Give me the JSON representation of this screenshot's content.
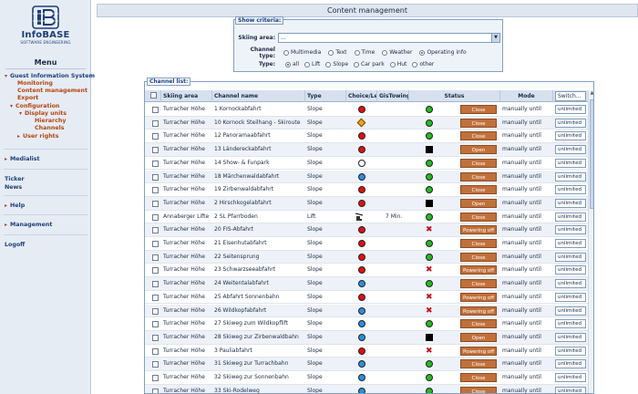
{
  "logo": {
    "name": "InfoBASE",
    "subtitle": "SOFTWARE ENGINEERING"
  },
  "menu": {
    "title": "Menu",
    "items": [
      {
        "label": "Guest Information System",
        "level": 0,
        "arrow": "▾"
      },
      {
        "label": "Monitoring",
        "level": 1
      },
      {
        "label": "Content management",
        "level": 1
      },
      {
        "label": "Export",
        "level": 1
      },
      {
        "label": "Configuration",
        "level": 1,
        "arrow": "▾"
      },
      {
        "label": "Display units",
        "level": 2,
        "arrow": "▾"
      },
      {
        "label": "Hierarchy",
        "level": 3
      },
      {
        "label": "Channels",
        "level": 3
      },
      {
        "label": "User rights",
        "level": 2,
        "arrow": "▸"
      },
      {
        "label": "Medialist",
        "level": 0,
        "arrow": "▸"
      },
      {
        "label": "Ticker",
        "level": 0
      },
      {
        "label": "News",
        "level": 0
      },
      {
        "label": "Help",
        "level": 0,
        "arrow": "▸"
      },
      {
        "label": "Management",
        "level": 0,
        "arrow": "▸"
      },
      {
        "label": "Logoff",
        "level": 0
      }
    ]
  },
  "page_title": "Content management",
  "criteria": {
    "legend": "Show criteria:",
    "skiing_area_label": "Skiing area:",
    "skiing_area_value": "...",
    "channel_type_label": "Channel type:",
    "channel_types": [
      {
        "label": "Multimedia",
        "selected": false
      },
      {
        "label": "Text",
        "selected": false
      },
      {
        "label": "Time",
        "selected": false
      },
      {
        "label": "Weather",
        "selected": false
      },
      {
        "label": "Operating info",
        "selected": true
      }
    ],
    "type_label": "Type:",
    "types": [
      {
        "label": "all",
        "selected": true
      },
      {
        "label": "Lift",
        "selected": false
      },
      {
        "label": "Slope",
        "selected": false
      },
      {
        "label": "Car park",
        "selected": false
      },
      {
        "label": "Hut",
        "selected": false
      },
      {
        "label": "other",
        "selected": false
      }
    ]
  },
  "channel_list": {
    "legend": "Channel list:",
    "columns": {
      "skiing_area": "Skiing area",
      "channel_name": "Channel name",
      "type": "Type",
      "choice_level": "Choice/Level",
      "gis_towing": "GisTowingG",
      "status": "Status",
      "mode": "Mode",
      "switch": "Switch..."
    },
    "colors": {
      "red": "#e01010",
      "green": "#22bb22",
      "blue": "#2a8fe0",
      "white": "#ffffff",
      "orange": "#f0a020",
      "status_button": "#c0703a"
    },
    "rows": [
      {
        "area": "Turracher Höhe",
        "name": "1 Kornockabfahrt",
        "type": "Slope",
        "choice": "red",
        "gis": "",
        "status": "green",
        "button": "Close",
        "mode": "manually until",
        "value": "unlimited"
      },
      {
        "area": "Turracher Höhe",
        "name": "10 Kornock Steilhang - Skiroute",
        "type": "Slope",
        "choice": "orange-diamond",
        "gis": "",
        "status": "green",
        "button": "Close",
        "mode": "manually until",
        "value": "unlimited"
      },
      {
        "area": "Turracher Höhe",
        "name": "12 Panoramaabfahrt",
        "type": "Slope",
        "choice": "red",
        "gis": "",
        "status": "green",
        "button": "Close",
        "mode": "manually until",
        "value": "unlimited"
      },
      {
        "area": "Turracher Höhe",
        "name": "13 Ländereckabfahrt",
        "type": "Slope",
        "choice": "red",
        "gis": "",
        "status": "black-square",
        "button": "Open",
        "mode": "manually until",
        "value": "unlimited"
      },
      {
        "area": "Turracher Höhe",
        "name": "14 Show- & Funpark",
        "type": "Slope",
        "choice": "white",
        "gis": "",
        "status": "green",
        "button": "Close",
        "mode": "manually until",
        "value": "unlimited"
      },
      {
        "area": "Turracher Höhe",
        "name": "18 Märchenwaldabfahrt",
        "type": "Slope",
        "choice": "blue",
        "gis": "",
        "status": "green",
        "button": "Close",
        "mode": "manually until",
        "value": "unlimited"
      },
      {
        "area": "Turracher Höhe",
        "name": "19 Zirbenwaldabfahrt",
        "type": "Slope",
        "choice": "red",
        "gis": "",
        "status": "green",
        "button": "Close",
        "mode": "manually until",
        "value": "unlimited"
      },
      {
        "area": "Turracher Höhe",
        "name": "2 Hirschkogelabfahrt",
        "type": "Slope",
        "choice": "red",
        "gis": "",
        "status": "black-square",
        "button": "Open",
        "mode": "manually until",
        "value": "unlimited"
      },
      {
        "area": "Annaberger Lifte",
        "name": "2 SL Pfarrboden",
        "type": "Lift",
        "choice": "lift-icon",
        "gis": "7 Min.",
        "status": "green",
        "button": "Close",
        "mode": "manually until",
        "value": "unlimited"
      },
      {
        "area": "Turracher Höhe",
        "name": "20 FIS-Abfahrt",
        "type": "Slope",
        "choice": "red",
        "gis": "",
        "status": "red-x",
        "button": "Powering off",
        "mode": "manually until",
        "value": "unlimited"
      },
      {
        "area": "Turracher Höhe",
        "name": "21 Eisenhutabfahrt",
        "type": "Slope",
        "choice": "red",
        "gis": "",
        "status": "green",
        "button": "Close",
        "mode": "manually until",
        "value": "unlimited"
      },
      {
        "area": "Turracher Höhe",
        "name": "22 Seitensprung",
        "type": "Slope",
        "choice": "red",
        "gis": "",
        "status": "green",
        "button": "Close",
        "mode": "manually until",
        "value": "unlimited"
      },
      {
        "area": "Turracher Höhe",
        "name": "23 Schwarzseeabfahrt",
        "type": "Slope",
        "choice": "red",
        "gis": "",
        "status": "red-x",
        "button": "Powering off",
        "mode": "manually until",
        "value": "unlimited"
      },
      {
        "area": "Turracher Höhe",
        "name": "24 Weitentalabfahrt",
        "type": "Slope",
        "choice": "blue",
        "gis": "",
        "status": "green",
        "button": "Close",
        "mode": "manually until",
        "value": "unlimited"
      },
      {
        "area": "Turracher Höhe",
        "name": "25 Abfahrt Sonnenbahn",
        "type": "Slope",
        "choice": "red",
        "gis": "",
        "status": "red-x",
        "button": "Powering off",
        "mode": "manually until",
        "value": "unlimited"
      },
      {
        "area": "Turracher Höhe",
        "name": "26 Wildkopfabfahrt",
        "type": "Slope",
        "choice": "blue",
        "gis": "",
        "status": "red-x",
        "button": "Powering off",
        "mode": "manually until",
        "value": "unlimited"
      },
      {
        "area": "Turracher Höhe",
        "name": "27 Skiweg zum Wildkopflift",
        "type": "Slope",
        "choice": "blue",
        "gis": "",
        "status": "green",
        "button": "Close",
        "mode": "manually until",
        "value": "unlimited"
      },
      {
        "area": "Turracher Höhe",
        "name": "28 Skiweg zur Zirbenwaldbahn",
        "type": "Slope",
        "choice": "blue",
        "gis": "",
        "status": "black-square",
        "button": "Open",
        "mode": "manually until",
        "value": "unlimited"
      },
      {
        "area": "Turracher Höhe",
        "name": "3 Pauliabfahrt",
        "type": "Slope",
        "choice": "red",
        "gis": "",
        "status": "red-x",
        "button": "Powering off",
        "mode": "manually until",
        "value": "unlimited"
      },
      {
        "area": "Turracher Höhe",
        "name": "31 Skiweg zur Turrachbahn",
        "type": "Slope",
        "choice": "blue",
        "gis": "",
        "status": "green",
        "button": "Close",
        "mode": "manually until",
        "value": "unlimited"
      },
      {
        "area": "Turracher Höhe",
        "name": "32 Skiweg zur Sonnenbahn",
        "type": "Slope",
        "choice": "blue",
        "gis": "",
        "status": "green",
        "button": "Close",
        "mode": "manually until",
        "value": "unlimited"
      },
      {
        "area": "Turracher Höhe",
        "name": "33 Ski-Rodelweg",
        "type": "Slope",
        "choice": "blue",
        "gis": "",
        "status": "green",
        "button": "Close",
        "mode": "manually until",
        "value": "unlimited"
      }
    ]
  }
}
